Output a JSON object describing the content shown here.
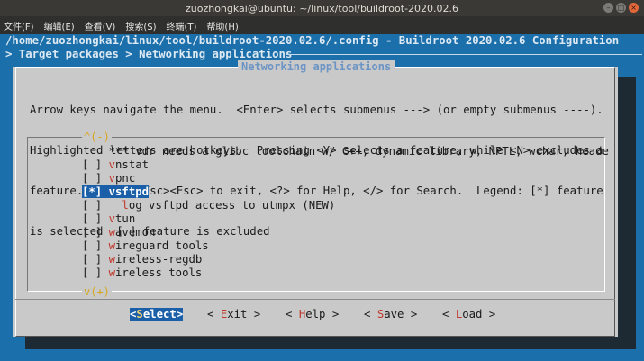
{
  "window": {
    "title": "zuozhongkai@ubuntu: ~/linux/tool/buildroot-2020.02.6"
  },
  "menubar": [
    "文件(F)",
    "编辑(E)",
    "查看(V)",
    "搜索(S)",
    "终端(T)",
    "帮助(H)"
  ],
  "terminal": {
    "config_path": "/home/zuozhongkai/linux/tool/buildroot-2020.02.6/.config - Buildroot 2020.02.6 Configuration",
    "breadcrumb": "> Target packages > Networking applications"
  },
  "dialog": {
    "title": "Networking applications",
    "help_lines": [
      "Arrow keys navigate the menu.  <Enter> selects submenus ---> (or empty submenus ----).",
      "Highlighted letters are hotkeys.  Pressing <Y> selects a feature, while <N> excludes a",
      "feature.  Press <Esc><Esc> to exit, <?> for Help, </> for Search.  Legend: [*] feature",
      "is selected  [ ] feature is excluded"
    ],
    "scroll_up": "^(-)",
    "scroll_down": "v(+)",
    "items": [
      {
        "prefix": "    ",
        "hot": "",
        "rest": "*** vdr needs a glibc toolchain w/ C++, dynamic library, NPTL, wchar, heade"
      },
      {
        "prefix": "[ ] ",
        "hot": "v",
        "rest": "nstat"
      },
      {
        "prefix": "[ ] ",
        "hot": "v",
        "rest": "pnc"
      },
      {
        "prefix": "[*] ",
        "hot": "v",
        "rest": "sftpd",
        "selected": true
      },
      {
        "prefix": "[ ]   ",
        "hot": "l",
        "rest": "og vsftpd access to utmpx (NEW)"
      },
      {
        "prefix": "[ ] ",
        "hot": "v",
        "rest": "tun"
      },
      {
        "prefix": "[ ] ",
        "hot": "w",
        "rest": "avemon"
      },
      {
        "prefix": "[ ] ",
        "hot": "w",
        "rest": "ireguard tools"
      },
      {
        "prefix": "[ ] ",
        "hot": "w",
        "rest": "ireless-regdb"
      },
      {
        "prefix": "[ ] ",
        "hot": "w",
        "rest": "ireless tools"
      }
    ],
    "buttons": [
      {
        "pre": "<",
        "hot": "S",
        "post": "elect>",
        "active": true
      },
      {
        "pre": "< ",
        "hot": "E",
        "post": "xit >",
        "active": false
      },
      {
        "pre": "< ",
        "hot": "H",
        "post": "elp >",
        "active": false
      },
      {
        "pre": "< ",
        "hot": "S",
        "post": "ave >",
        "active": false
      },
      {
        "pre": "< ",
        "hot": "L",
        "post": "oad >",
        "active": false
      }
    ]
  }
}
